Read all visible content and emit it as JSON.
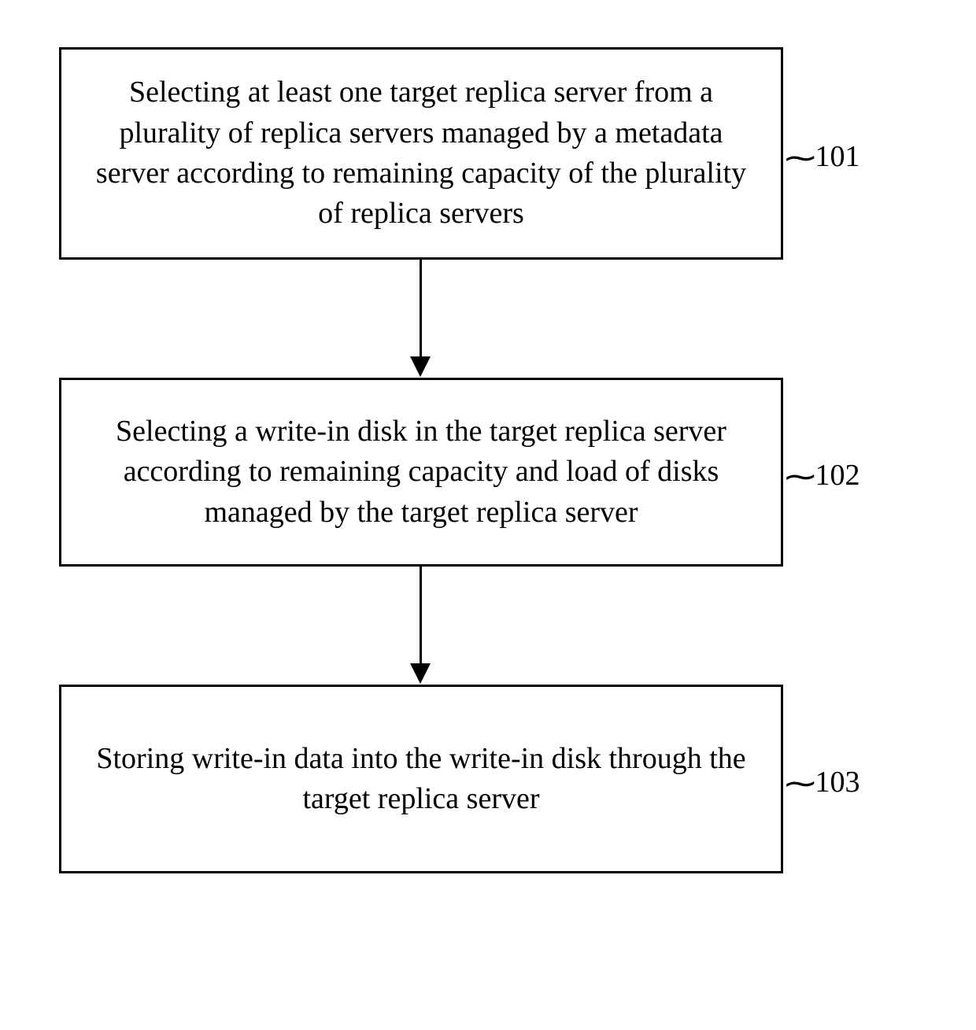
{
  "steps": [
    {
      "text": "Selecting at least one target replica server from a plurality of replica servers managed by a metadata server according to remaining capacity of the plurality of replica servers",
      "label": "101"
    },
    {
      "text": "Selecting a write-in disk in the target replica server according to remaining capacity and load of disks managed by the target replica server",
      "label": "102"
    },
    {
      "text": "Storing write-in data into the write-in disk through the target replica server",
      "label": "103"
    }
  ]
}
